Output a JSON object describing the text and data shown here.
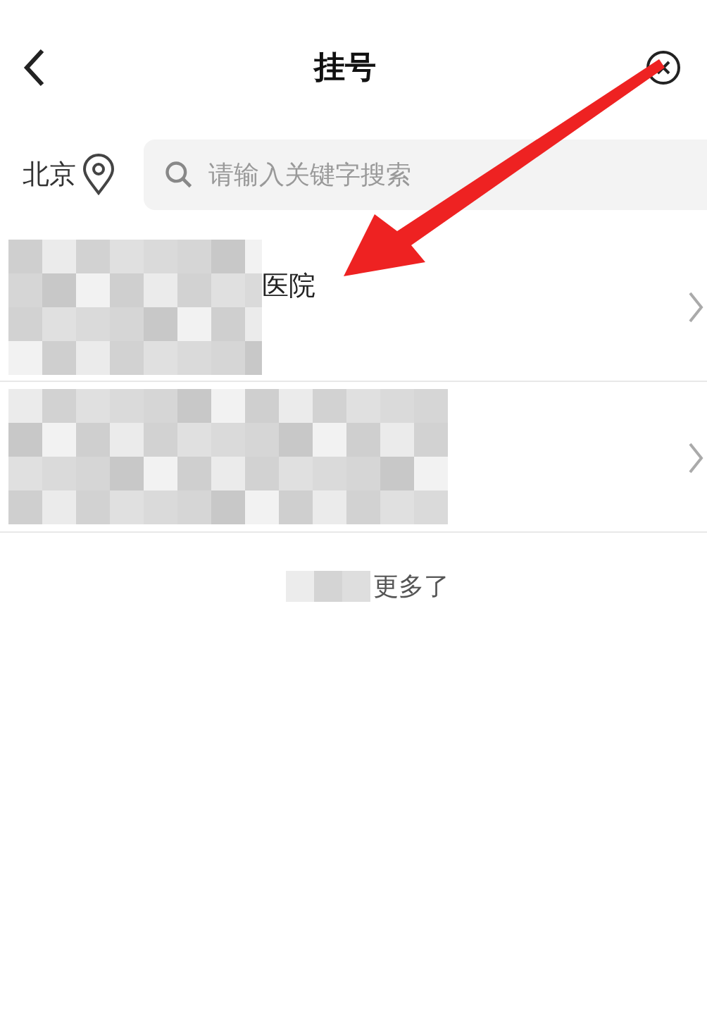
{
  "header": {
    "title": "挂号"
  },
  "location": {
    "city": "北京"
  },
  "search": {
    "placeholder": "请输入关键字搜索"
  },
  "results": [
    {
      "kind": "named",
      "name": "医院"
    },
    {
      "kind": "blurred"
    }
  ],
  "footer": {
    "text": "更多了"
  }
}
